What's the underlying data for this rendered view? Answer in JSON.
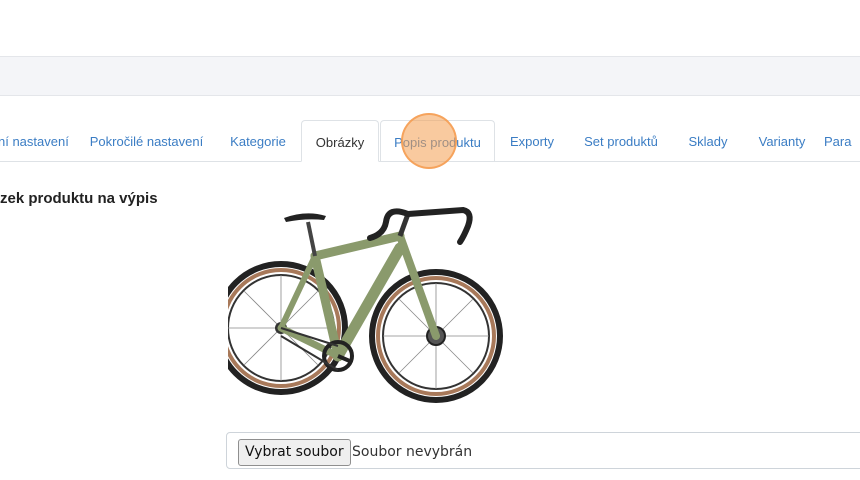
{
  "tabs": [
    {
      "label": "ní nastavení",
      "active": false
    },
    {
      "label": "Pokročilé nastavení",
      "active": false
    },
    {
      "label": "Kategorie",
      "active": false
    },
    {
      "label": "Obrázky",
      "active": true
    },
    {
      "label": "Popis produktu",
      "active": false
    },
    {
      "label": "Exporty",
      "active": false
    },
    {
      "label": "Set produktů",
      "active": false
    },
    {
      "label": "Sklady",
      "active": false
    },
    {
      "label": "Varianty",
      "active": false
    },
    {
      "label": "Para",
      "active": false
    }
  ],
  "section": {
    "label": "zek produktu na výpis"
  },
  "file_input": {
    "button_label": "Vybrat soubor",
    "status": "Soubor nevybrán"
  },
  "colors": {
    "link": "#3b7dc4",
    "active_tab_text": "#333333",
    "bike_frame": "#8a9a6c",
    "tire_wall": "#a8795a",
    "click_indicator": "#f49e50"
  }
}
